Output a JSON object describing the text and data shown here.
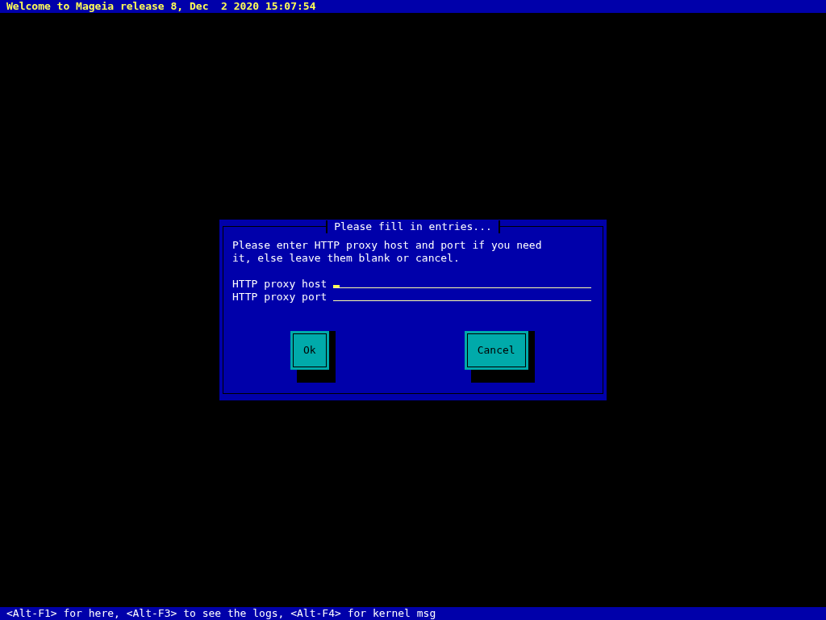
{
  "top_bar": {
    "text": "Welcome to Mageia release 8, Dec  2 2020 15:07:54"
  },
  "dialog": {
    "title": "Please fill in entries...",
    "message": "Please enter HTTP proxy host and port if you need\nit, else leave them blank or cancel.",
    "fields": [
      {
        "label": "HTTP proxy host",
        "focused": true
      },
      {
        "label": "HTTP proxy port",
        "focused": false
      }
    ],
    "buttons": [
      "Ok",
      "Cancel"
    ]
  },
  "status_bar": {
    "text": "<Alt-F1> for here, <Alt-F3> to see the logs, <Alt-F4> for kernel msg"
  }
}
